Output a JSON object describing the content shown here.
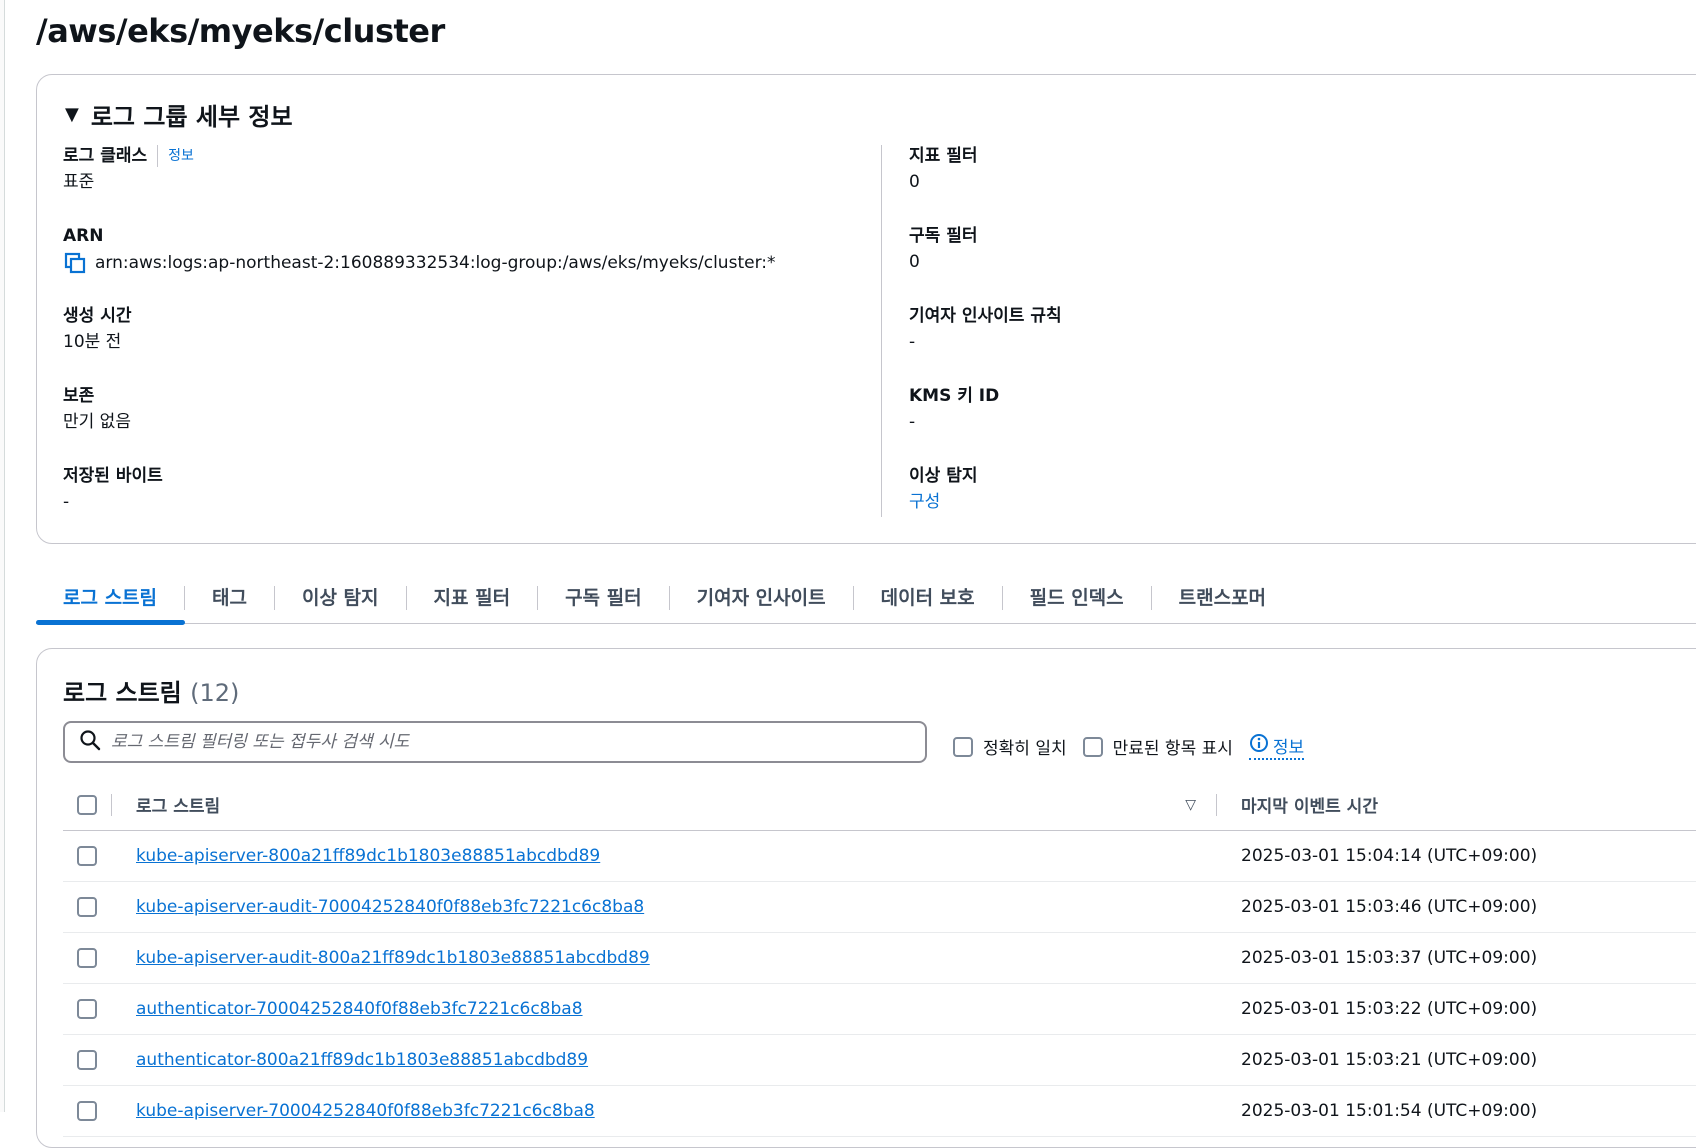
{
  "page": {
    "title": "/aws/eks/myeks/cluster"
  },
  "details": {
    "header": "로그 그룹 세부 정보",
    "left": [
      {
        "label": "로그 클래스",
        "info": "정보",
        "value": "표준"
      },
      {
        "label": "ARN",
        "value": "arn:aws:logs:ap-northeast-2:160889332534:log-group:/aws/eks/myeks/cluster:*"
      },
      {
        "label": "생성 시간",
        "value": "10분 전"
      },
      {
        "label": "보존",
        "value": "만기 없음"
      },
      {
        "label": "저장된 바이트",
        "value": "-"
      }
    ],
    "right": [
      {
        "label": "지표 필터",
        "value": "0"
      },
      {
        "label": "구독 필터",
        "value": "0"
      },
      {
        "label": "기여자 인사이트 규칙",
        "value": "-"
      },
      {
        "label": "KMS 키 ID",
        "value": "-"
      },
      {
        "label": "이상 탐지",
        "value": "구성"
      }
    ]
  },
  "tabs": [
    "로그 스트림",
    "태그",
    "이상 탐지",
    "지표 필터",
    "구독 필터",
    "기여자 인사이트",
    "데이터 보호",
    "필드 인덱스",
    "트랜스포머"
  ],
  "streams": {
    "title": "로그 스트림",
    "count": "(12)",
    "search_placeholder": "로그 스트림 필터링 또는 접두사 검색 시도",
    "exact_match_label": "정확히 일치",
    "show_expired_label": "만료된 항목 표시",
    "info_label": "정보",
    "columns": {
      "name": "로그 스트림",
      "last_event": "마지막 이벤트 시간"
    },
    "rows": [
      {
        "name": "kube-apiserver-800a21ff89dc1b1803e88851abcdbd89",
        "time": "2025-03-01 15:04:14 (UTC+09:00)"
      },
      {
        "name": "kube-apiserver-audit-70004252840f0f88eb3fc7221c6c8ba8",
        "time": "2025-03-01 15:03:46 (UTC+09:00)"
      },
      {
        "name": "kube-apiserver-audit-800a21ff89dc1b1803e88851abcdbd89",
        "time": "2025-03-01 15:03:37 (UTC+09:00)"
      },
      {
        "name": "authenticator-70004252840f0f88eb3fc7221c6c8ba8",
        "time": "2025-03-01 15:03:22 (UTC+09:00)"
      },
      {
        "name": "authenticator-800a21ff89dc1b1803e88851abcdbd89",
        "time": "2025-03-01 15:03:21 (UTC+09:00)"
      },
      {
        "name": "kube-apiserver-70004252840f0f88eb3fc7221c6c8ba8",
        "time": "2025-03-01 15:01:54 (UTC+09:00)"
      }
    ]
  },
  "colors": {
    "link": "#0972d3",
    "border": "#c6c6cd",
    "text": "#0f141a"
  }
}
